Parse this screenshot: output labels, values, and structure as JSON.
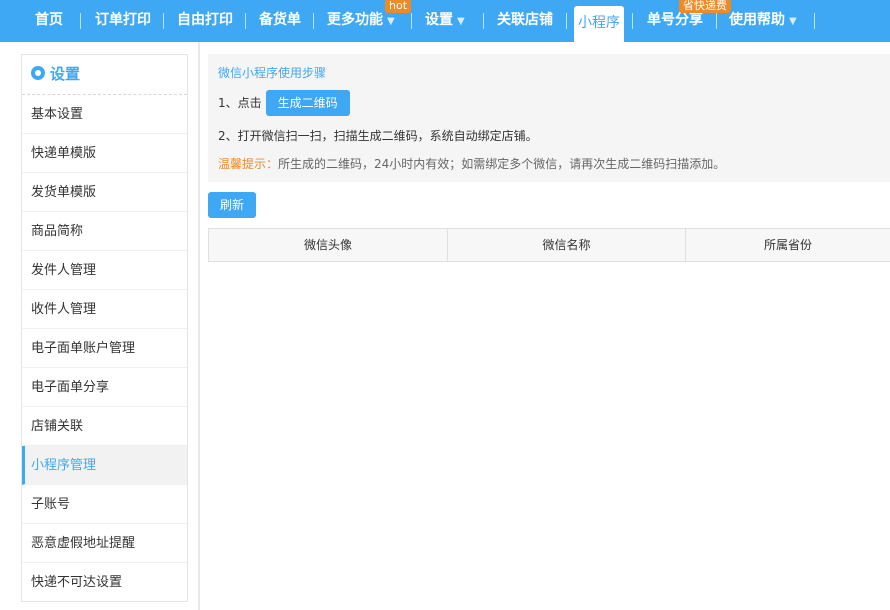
{
  "nav": {
    "items": [
      {
        "label": "首页"
      },
      {
        "label": "订单打印"
      },
      {
        "label": "自由打印"
      },
      {
        "label": "备货单"
      },
      {
        "label": "更多功能",
        "badge": "hot"
      },
      {
        "label": "设置"
      },
      {
        "label": "关联店铺"
      },
      {
        "label": "小程序"
      },
      {
        "label": "单号分享",
        "badge": "省快递费"
      },
      {
        "label": "使用帮助"
      }
    ],
    "arrow": "▼"
  },
  "sidebar": {
    "title": "设置",
    "items": [
      {
        "label": "基本设置"
      },
      {
        "label": "快递单模版"
      },
      {
        "label": "发货单模版"
      },
      {
        "label": "商品简称"
      },
      {
        "label": "发件人管理"
      },
      {
        "label": "收件人管理"
      },
      {
        "label": "电子面单账户管理"
      },
      {
        "label": "电子面单分享"
      },
      {
        "label": "店铺关联"
      },
      {
        "label": "小程序管理"
      },
      {
        "label": "子账号"
      },
      {
        "label": "恶意虚假地址提醒"
      },
      {
        "label": "快递不可达设置"
      }
    ],
    "active_index": 9
  },
  "steps": {
    "title": "微信小程序使用步骤",
    "step1_prefix": "1、点击",
    "generate_button": "生成二维码",
    "step2": "2、打开微信扫一扫，扫描生成二维码，系统自动绑定店铺。",
    "tip_label": "温馨提示：",
    "tip_text": "所生成的二维码，24小时内有效；如需绑定多个微信，请再次生成二维码扫描添加。"
  },
  "refresh_button": "刷新",
  "table": {
    "headers": [
      "微信头像",
      "微信名称",
      "所属省份"
    ]
  },
  "colors": {
    "primary": "#3fa8f4",
    "accent": "#f08a24"
  }
}
